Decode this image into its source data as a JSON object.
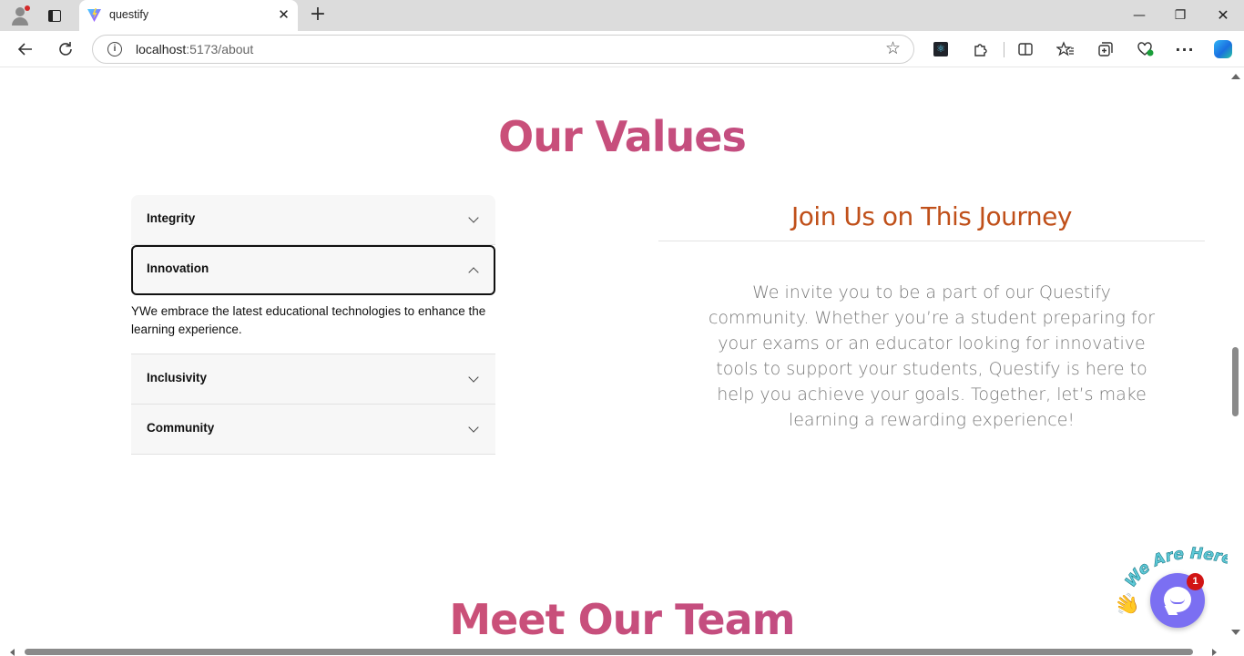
{
  "browser": {
    "tab_title": "questify",
    "url_host": "localhost",
    "url_path": ":5173/about",
    "new_tab_symbol": "+",
    "close_symbol": "✕",
    "minimize_symbol": "—",
    "restore_symbol": "❐",
    "window_close_symbol": "✕",
    "icons": [
      "profile-icon",
      "tab-actions-icon",
      "vite-favicon",
      "back-icon",
      "reload-icon",
      "site-info-icon",
      "favorite-star-icon",
      "react-devtools-icon",
      "extensions-icon",
      "split-screen-icon",
      "favorites-icon",
      "collections-icon",
      "browser-essentials-icon",
      "more-icon",
      "copilot-icon"
    ]
  },
  "values": {
    "title": "Our Values",
    "items": [
      {
        "label": "Integrity",
        "expanded": false
      },
      {
        "label": "Innovation",
        "expanded": true,
        "body": "YWe embrace the latest educational technologies to enhance the learning experience."
      },
      {
        "label": "Inclusivity",
        "expanded": false
      },
      {
        "label": "Community",
        "expanded": false
      }
    ]
  },
  "journey": {
    "title": "Join Us on This Journey",
    "text": "We invite you to be a part of our Questify community. Whether you’re a student preparing for your exams or an educator looking for innovative tools to support your students, Questify is here to help you achieve your goals. Together, let’s make learning a rewarding experience!"
  },
  "team": {
    "title": "Meet Our Team"
  },
  "chat": {
    "banner": "We Are Here!",
    "badge_count": "1",
    "wave_emoji": "👋"
  },
  "colors": {
    "heading_gradient_start": "#d6546a",
    "heading_gradient_end": "#b7498f",
    "journey_title": "#c0501a",
    "chat_button": "#7b6ff2",
    "badge": "#d11414"
  }
}
